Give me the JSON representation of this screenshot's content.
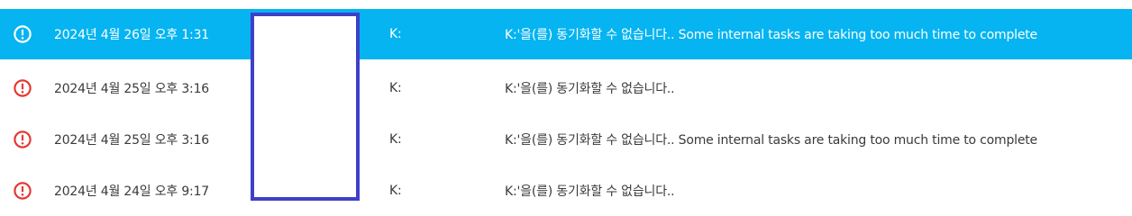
{
  "rows": [
    {
      "time": "2024년 4월 26일 오후 1:31",
      "drive": "K:",
      "message": "K:'을(를) 동기화할 수 없습니다.. Some internal tasks are taking too much time to complete",
      "icon": "error-circle-icon",
      "selected": true
    },
    {
      "time": "2024년 4월 25일 오후 3:16",
      "drive": "K:",
      "message": "K:'을(를) 동기화할 수 없습니다..",
      "icon": "error-circle-icon",
      "selected": false
    },
    {
      "time": "2024년 4월 25일 오후 3:16",
      "drive": "K:",
      "message": "K:'을(를) 동기화할 수 없습니다.. Some internal tasks are taking too much time to complete",
      "icon": "error-circle-icon",
      "selected": false
    },
    {
      "time": "2024년 4월 24일 오후 9:17",
      "drive": "K:",
      "message": "K:'을(를) 동기화할 수 없습니다..",
      "icon": "error-circle-icon",
      "selected": false
    }
  ],
  "colors": {
    "selected_background": "#05b4f1",
    "error_icon": "#e53935",
    "redaction_border": "#3f3fc8"
  }
}
